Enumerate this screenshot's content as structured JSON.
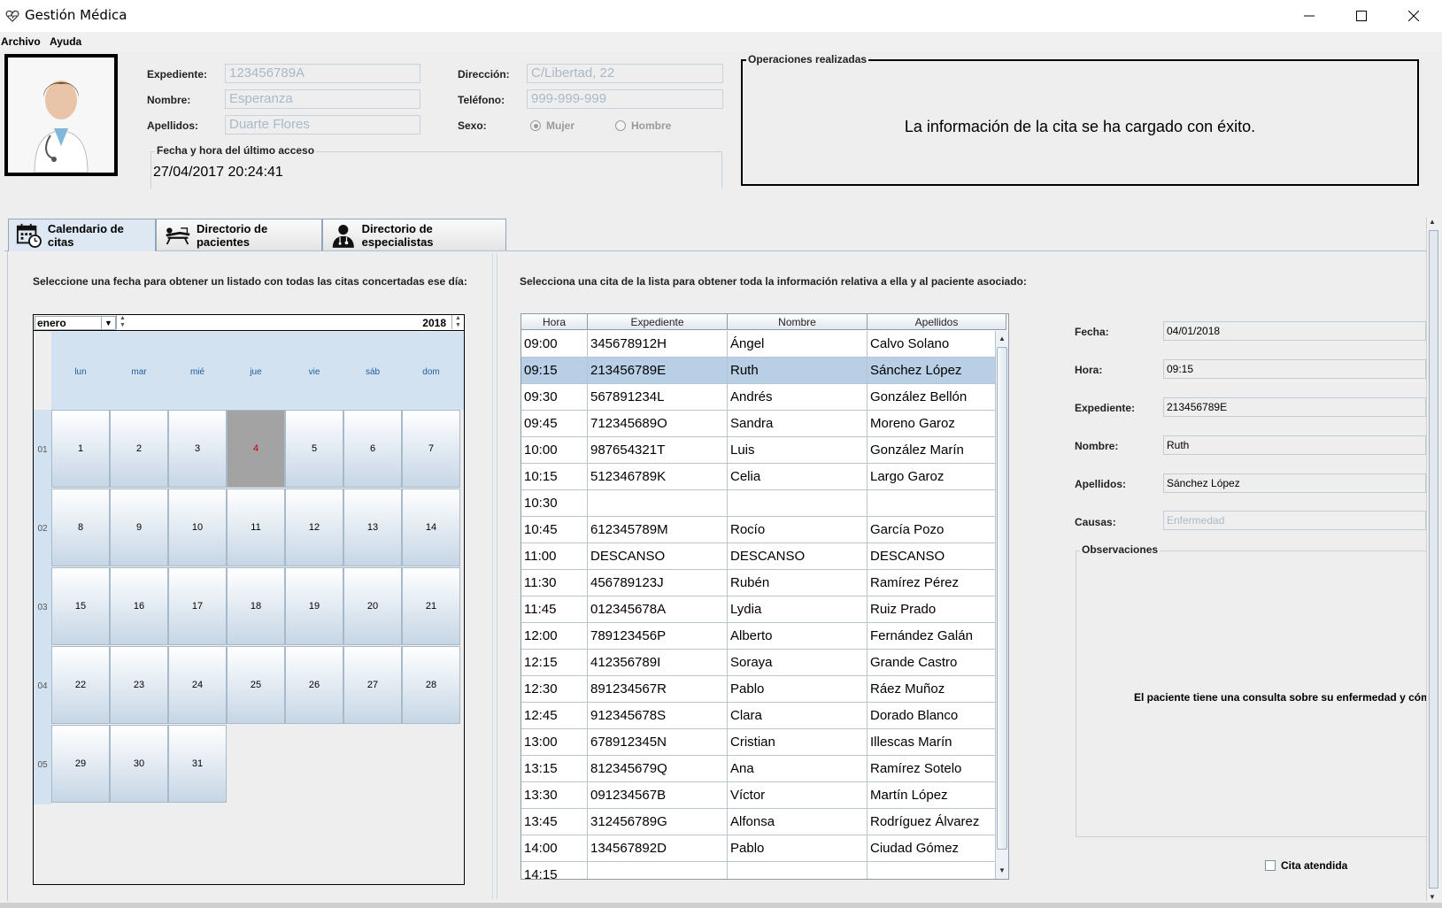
{
  "window": {
    "title": "Gestión Médica"
  },
  "menu": [
    "Archivo",
    "Ayuda"
  ],
  "patient_header": {
    "expediente_label": "Expediente:",
    "expediente_value": "123456789A",
    "nombre_label": "Nombre:",
    "nombre_value": "Esperanza",
    "apellidos_label": "Apellidos:",
    "apellidos_value": "Duarte Flores",
    "direccion_label": "Dirección:",
    "direccion_value": "C/Libertad, 22",
    "telefono_label": "Teléfono:",
    "telefono_value": "999-999-999",
    "sexo_label": "Sexo:",
    "sexo_options": [
      "Mujer",
      "Hombre"
    ],
    "sexo_selected": "Mujer",
    "last_access_label": "Fecha y hora del último acceso",
    "last_access_value": "27/04/2017 20:24:41"
  },
  "operations": {
    "label": "Operaciones realizadas",
    "message": "La información de la cita se ha cargado con éxito."
  },
  "tabs": [
    {
      "label": "Calendario de citas",
      "icon": "calendar-clock-icon",
      "active": true
    },
    {
      "label": "Directorio de pacientes",
      "icon": "patient-bed-icon",
      "active": false
    },
    {
      "label": "Directorio de especialistas",
      "icon": "doctor-icon",
      "active": false
    }
  ],
  "calendar_panel": {
    "hint": "Seleccione una fecha para obtener un listado con todas las citas concertadas ese día:",
    "month": "enero",
    "year": "2018",
    "day_names": [
      "lun",
      "mar",
      "mié",
      "jue",
      "vie",
      "sáb",
      "dom"
    ],
    "weeks": [
      {
        "num": "01",
        "days": [
          "1",
          "2",
          "3",
          "4",
          "5",
          "6",
          "7"
        ]
      },
      {
        "num": "02",
        "days": [
          "8",
          "9",
          "10",
          "11",
          "12",
          "13",
          "14"
        ]
      },
      {
        "num": "03",
        "days": [
          "15",
          "16",
          "17",
          "18",
          "19",
          "20",
          "21"
        ]
      },
      {
        "num": "04",
        "days": [
          "22",
          "23",
          "24",
          "25",
          "26",
          "27",
          "28"
        ]
      },
      {
        "num": "05",
        "days": [
          "29",
          "30",
          "31"
        ]
      }
    ],
    "selected_day": "4"
  },
  "appointments_panel": {
    "hint": "Selecciona una cita de la lista para obtener toda la información relativa a ella y al paciente asociado:",
    "columns": [
      "Hora",
      "Expediente",
      "Nombre",
      "Apellidos"
    ],
    "rows": [
      [
        "09:00",
        "345678912H",
        "Ángel",
        "Calvo Solano"
      ],
      [
        "09:15",
        "213456789E",
        "Ruth",
        "Sánchez López"
      ],
      [
        "09:30",
        "567891234L",
        "Andrés",
        "González Bellón"
      ],
      [
        "09:45",
        "712345689O",
        "Sandra",
        "Moreno Garoz"
      ],
      [
        "10:00",
        "987654321T",
        "Luis",
        "González Marín"
      ],
      [
        "10:15",
        "512346789K",
        "Celia",
        "Largo Garoz"
      ],
      [
        "10:30",
        "",
        "",
        ""
      ],
      [
        "10:45",
        "612345789M",
        "Rocío",
        "García Pozo"
      ],
      [
        "11:00",
        "DESCANSO",
        "DESCANSO",
        "DESCANSO"
      ],
      [
        "11:30",
        "456789123J",
        "Rubén",
        "Ramírez Pérez"
      ],
      [
        "11:45",
        "012345678A",
        "Lydia",
        "Ruiz Prado"
      ],
      [
        "12:00",
        "789123456P",
        "Alberto",
        "Fernández Galán"
      ],
      [
        "12:15",
        "412356789I",
        "Soraya",
        "Grande Castro"
      ],
      [
        "12:30",
        "891234567R",
        "Pablo",
        "Ráez Muñoz"
      ],
      [
        "12:45",
        "912345678S",
        "Clara",
        "Dorado Blanco"
      ],
      [
        "13:00",
        "678912345N",
        "Cristian",
        "Illescas Marín"
      ],
      [
        "13:15",
        "812345679Q",
        "Ana",
        "Ramírez Sotelo"
      ],
      [
        "13:30",
        "091234567B",
        "Víctor",
        "Martín López"
      ],
      [
        "13:45",
        "312456789G",
        "Alfonsa",
        "Rodríguez Álvarez"
      ],
      [
        "14:00",
        "134567892D",
        "Pablo",
        "Ciudad Gómez"
      ],
      [
        "14:15",
        "",
        "",
        ""
      ]
    ],
    "selected_row": 1
  },
  "detail": {
    "fecha_label": "Fecha:",
    "fecha_value": "04/01/2018",
    "hora_label": "Hora:",
    "hora_value": "09:15",
    "expediente_label": "Expediente:",
    "expediente_value": "213456789E",
    "nombre_label": "Nombre:",
    "nombre_value": "Ruth",
    "apellidos_label": "Apellidos:",
    "apellidos_value": "Sánchez López",
    "causas_label": "Causas:",
    "causas_value": "Enfermedad",
    "observaciones_label": "Observaciones",
    "observaciones_value": "El paciente tiene una consulta sobre su enfermedad y cóm",
    "cita_atendida_label": "Cita atendida",
    "cita_atendida_checked": false
  }
}
